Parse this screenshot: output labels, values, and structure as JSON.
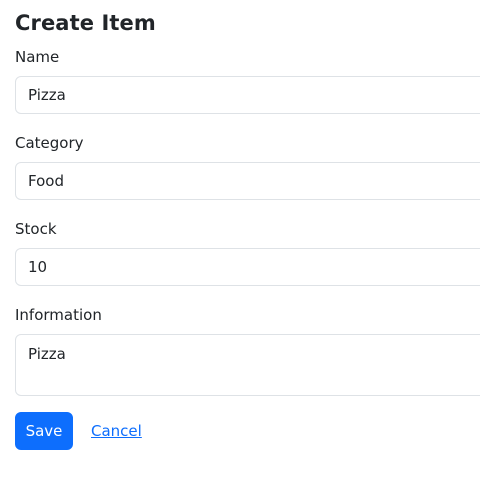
{
  "page": {
    "title": "Create Item"
  },
  "form": {
    "name": {
      "label": "Name",
      "value": "Pizza"
    },
    "category": {
      "label": "Category",
      "value": "Food"
    },
    "stock": {
      "label": "Stock",
      "value": "10"
    },
    "information": {
      "label": "Information",
      "value": "Pizza"
    },
    "actions": {
      "save_label": "Save",
      "cancel_label": "Cancel"
    }
  },
  "colors": {
    "primary": "#0d6efd",
    "text": "#212529",
    "border": "#dee2e6"
  }
}
